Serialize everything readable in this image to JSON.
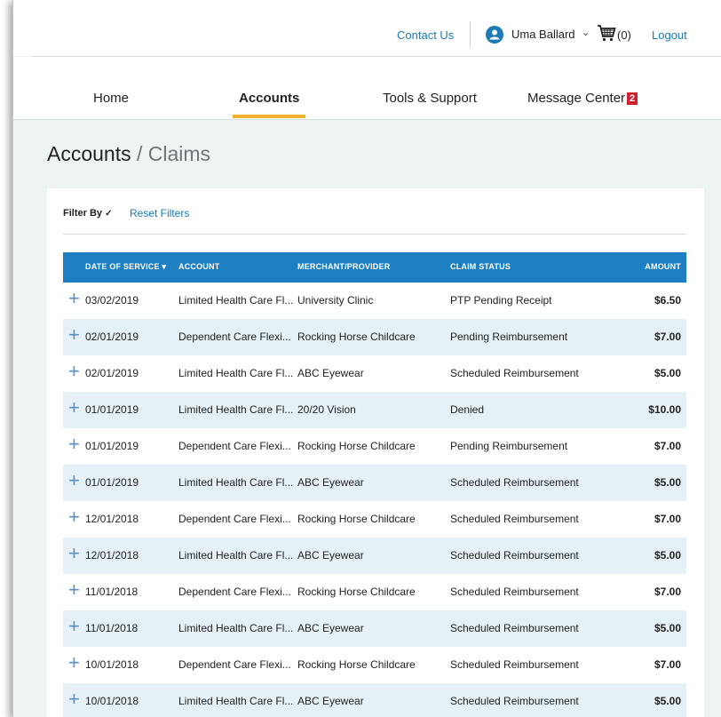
{
  "header": {
    "contact_label": "Contact Us",
    "avatar_glyph": "•",
    "user_name": "Uma Ballard",
    "cart_count": "(0)",
    "logout_label": "Logout"
  },
  "nav": {
    "home": "Home",
    "accounts": "Accounts",
    "tools": "Tools & Support",
    "messages": "Message Center",
    "message_count": "2"
  },
  "page": {
    "title": "Accounts",
    "separator": " / ",
    "subtitle": "Claims"
  },
  "filters": {
    "filter_by": "Filter By",
    "reset": "Reset Filters"
  },
  "table": {
    "columns": {
      "date": "Date of Service",
      "account": "Account",
      "merchant": "Merchant/Provider",
      "status": "Claim Status",
      "amount": "Amount"
    },
    "rows": [
      {
        "date": "03/02/2019",
        "account": "Limited Health Care Fl...",
        "merchant": "University Clinic",
        "status": "PTP Pending Receipt",
        "amount": "$6.50"
      },
      {
        "date": "02/01/2019",
        "account": "Dependent Care Flexi...",
        "merchant": "Rocking Horse Childcare",
        "status": "Pending Reimbursement",
        "amount": "$7.00"
      },
      {
        "date": "02/01/2019",
        "account": "Limited Health Care Fl...",
        "merchant": "ABC Eyewear",
        "status": "Scheduled Reimbursement",
        "amount": "$5.00"
      },
      {
        "date": "01/01/2019",
        "account": "Limited Health Care Fl...",
        "merchant": "20/20 Vision",
        "status": "Denied",
        "amount": "$10.00"
      },
      {
        "date": "01/01/2019",
        "account": "Dependent Care Flexi...",
        "merchant": "Rocking Horse Childcare",
        "status": "Pending Reimbursement",
        "amount": "$7.00"
      },
      {
        "date": "01/01/2019",
        "account": "Limited Health Care Fl...",
        "merchant": "ABC Eyewear",
        "status": "Scheduled Reimbursement",
        "amount": "$5.00"
      },
      {
        "date": "12/01/2018",
        "account": "Dependent Care Flexi...",
        "merchant": "Rocking Horse Childcare",
        "status": "Scheduled Reimbursement",
        "amount": "$7.00"
      },
      {
        "date": "12/01/2018",
        "account": "Limited Health Care Fl...",
        "merchant": "ABC Eyewear",
        "status": "Scheduled Reimbursement",
        "amount": "$5.00"
      },
      {
        "date": "11/01/2018",
        "account": "Dependent Care Flexi...",
        "merchant": "Rocking Horse Childcare",
        "status": "Scheduled Reimbursement",
        "amount": "$7.00"
      },
      {
        "date": "11/01/2018",
        "account": "Limited Health Care Fl...",
        "merchant": "ABC Eyewear",
        "status": "Scheduled Reimbursement",
        "amount": "$5.00"
      },
      {
        "date": "10/01/2018",
        "account": "Dependent Care Flexi...",
        "merchant": "Rocking Horse Childcare",
        "status": "Scheduled Reimbursement",
        "amount": "$7.00"
      },
      {
        "date": "10/01/2018",
        "account": "Limited Health Care Fl...",
        "merchant": "ABC Eyewear",
        "status": "Scheduled Reimbursement",
        "amount": "$5.00"
      }
    ]
  },
  "colors": {
    "accent": "#1d7fc1",
    "nav_underline": "#f1b12d",
    "badge": "#d0202e",
    "row_alt": "#e5f1f6"
  },
  "icons": {
    "user": "user-icon",
    "cart": "cart-icon",
    "expand": "plus-icon",
    "sort": "sort-down-icon",
    "chevron": "chevron-down-icon"
  }
}
